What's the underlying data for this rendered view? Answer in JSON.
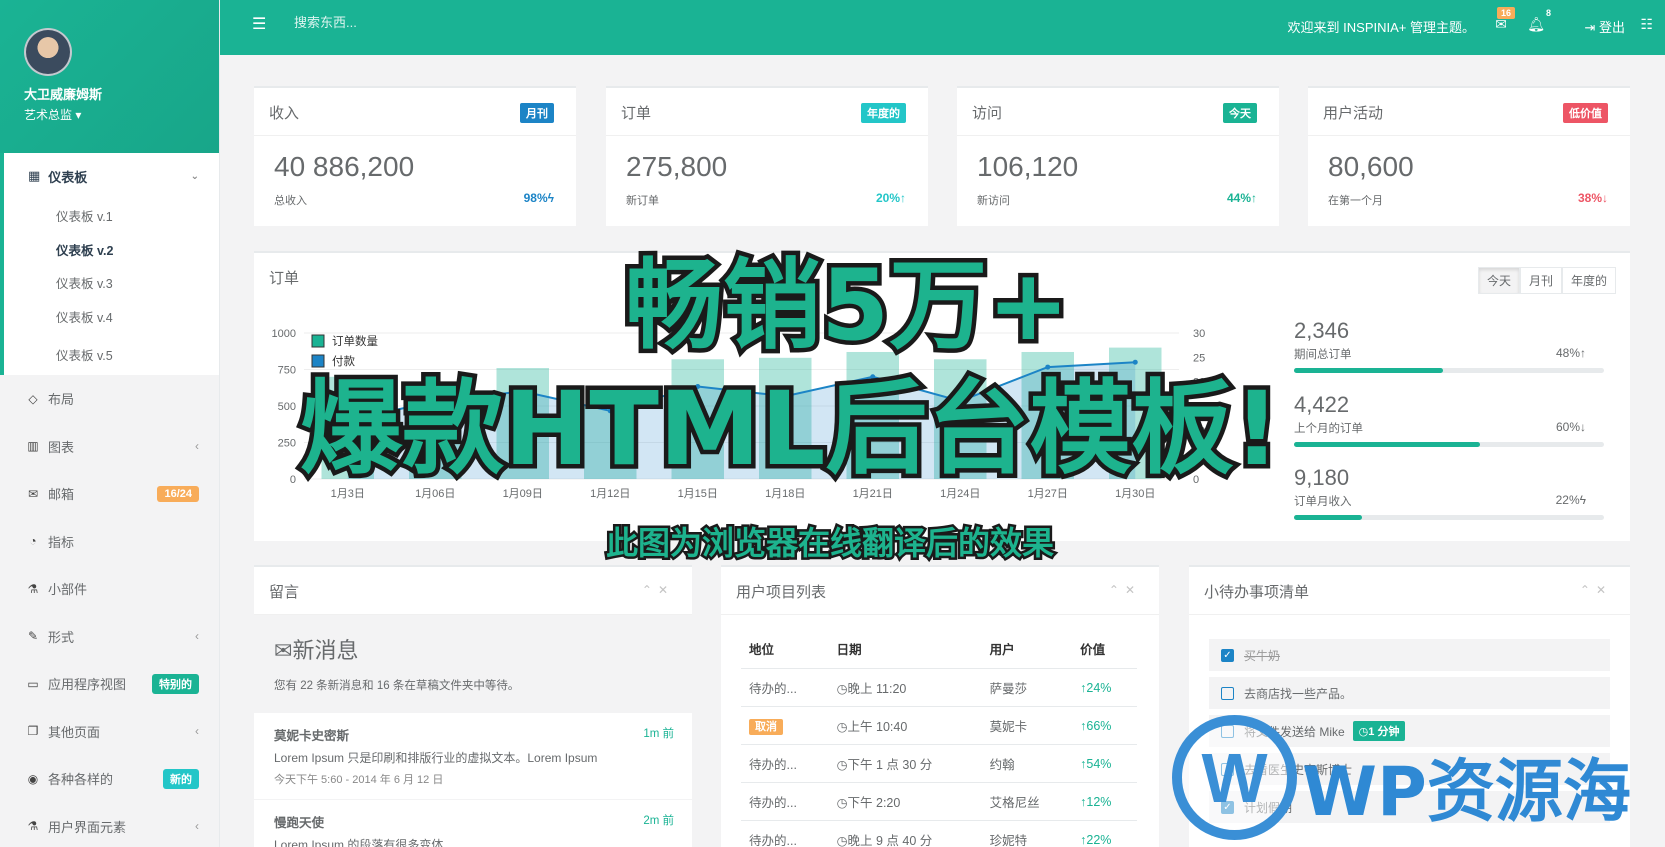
{
  "sidebar": {
    "user_name": "大卫威廉姆斯",
    "user_role": "艺术总监",
    "dashboard_label": "仪表板",
    "sub_items": [
      "仪表板 v.1",
      "仪表板 v.2",
      "仪表板 v.3",
      "仪表板 v.4",
      "仪表板 v.5"
    ],
    "items": [
      {
        "label": "布局",
        "icon": "diamond-icon"
      },
      {
        "label": "图表",
        "icon": "bar-chart-icon"
      },
      {
        "label": "邮箱",
        "icon": "envelope-icon",
        "badge": "16/24"
      },
      {
        "label": "指标",
        "icon": "pie-chart-icon"
      },
      {
        "label": "小部件",
        "icon": "flask-icon"
      },
      {
        "label": "形式",
        "icon": "edit-icon"
      },
      {
        "label": "应用程序视图",
        "icon": "desktop-icon",
        "badge": "特别的"
      },
      {
        "label": "其他页面",
        "icon": "files-icon"
      },
      {
        "label": "各种各样的",
        "icon": "globe-icon",
        "badge": "新的"
      },
      {
        "label": "用户界面元素",
        "icon": "flask-icon"
      }
    ]
  },
  "topbar": {
    "search_placeholder": "搜索东西...",
    "welcome": "欢迎来到 INSPINIA+ 管理主题。",
    "mail_count": "16",
    "bell_count": "8",
    "logout": "登出"
  },
  "stats": [
    {
      "title": "收入",
      "label": "月刊",
      "value": "40 886,200",
      "sub": "总收入",
      "pct": "98%",
      "color": "#1c84c6"
    },
    {
      "title": "订单",
      "label": "年度的",
      "value": "275,800",
      "sub": "新订单",
      "pct": "20%",
      "color": "#23c6c8"
    },
    {
      "title": "访问",
      "label": "今天",
      "value": "106,120",
      "sub": "新访问",
      "pct": "44%",
      "color": "#1ab394"
    },
    {
      "title": "用户活动",
      "label": "低价值",
      "value": "80,600",
      "sub": "在第一个月",
      "pct": "38%",
      "color": "#ed5565"
    }
  ],
  "orders_panel": {
    "title": "订单",
    "buttons": [
      "今天",
      "月刊",
      "年度的"
    ],
    "legend": [
      "订单数量",
      "付款"
    ],
    "mini": [
      {
        "value": "2,346",
        "label": "期间总订单",
        "pct": "48%",
        "fill": 0.48
      },
      {
        "value": "4,422",
        "label": "上个月的订单",
        "pct": "60%",
        "fill": 0.6
      },
      {
        "value": "9,180",
        "label": "订单月收入",
        "pct": "22%",
        "fill": 0.22
      }
    ]
  },
  "chart_data": {
    "type": "bar",
    "categories": [
      "1月3日",
      "1月06日",
      "1月09日",
      "1月12日",
      "1月15日",
      "1月18日",
      "1月21日",
      "1月24日",
      "1月27日",
      "1月30日"
    ],
    "series": [
      {
        "name": "订单数量",
        "values": [
          700,
          400,
          760,
          500,
          820,
          830,
          870,
          820,
          870,
          900
        ]
      },
      {
        "name": "付款",
        "values": [
          12,
          16,
          18,
          14,
          19,
          17,
          21,
          16,
          23,
          24
        ]
      }
    ],
    "y_left": [
      0,
      250,
      500,
      750,
      1000
    ],
    "y_right": [
      0,
      5,
      10,
      15,
      20,
      25,
      30
    ],
    "ylim": [
      0,
      1000
    ],
    "y2lim": [
      0,
      30
    ]
  },
  "messages": {
    "title": "留言",
    "heading": "新消息",
    "summary": "您有 22 条新消息和 16 条在草稿文件夹中等待。",
    "feeds": [
      {
        "name": "莫妮卡史密斯",
        "time": "1m 前",
        "body": "Lorem Ipsum 只是印刷和排版行业的虚拟文本。Lorem Ipsum",
        "date": "今天下午 5:60 - 2014 年 6 月 12 日"
      },
      {
        "name": "慢跑天使",
        "time": "2m 前",
        "body": "Lorem Ipsum 的段落有很多变体",
        "date": ""
      }
    ]
  },
  "projects": {
    "title": "用户项目列表",
    "headers": [
      "地位",
      "日期",
      "用户",
      "价值"
    ],
    "rows": [
      {
        "status": "待办的...",
        "date": "晚上 11:20",
        "user": "萨曼莎",
        "value": "24%"
      },
      {
        "status": "取消",
        "date": "上午 10:40",
        "user": "莫妮卡",
        "value": "66%"
      },
      {
        "status": "待办的...",
        "date": "下午 1 点 30 分",
        "user": "约翰",
        "value": "54%"
      },
      {
        "status": "待办的...",
        "date": "下午 2:20",
        "user": "艾格尼丝",
        "value": "12%"
      },
      {
        "status": "待办的...",
        "date": "晚上 9 点 40 分",
        "user": "珍妮特",
        "value": "22%"
      }
    ]
  },
  "todo": {
    "title": "小待办事项清单",
    "items": [
      {
        "text": "买牛奶",
        "done": true
      },
      {
        "text": "去商店找一些产品。",
        "done": false
      },
      {
        "text": "将文件发送给 Mike",
        "done": false,
        "tag": "1 分钟"
      },
      {
        "text": "去看医生史密斯博士",
        "done": false
      },
      {
        "text": "计划假期",
        "done": true
      }
    ]
  },
  "overlay": {
    "line1": "畅销5万+",
    "line2": "爆款HTML后台模板!",
    "line3": "此图为浏览器在线翻译后的效果",
    "watermark": "WP资源海"
  }
}
